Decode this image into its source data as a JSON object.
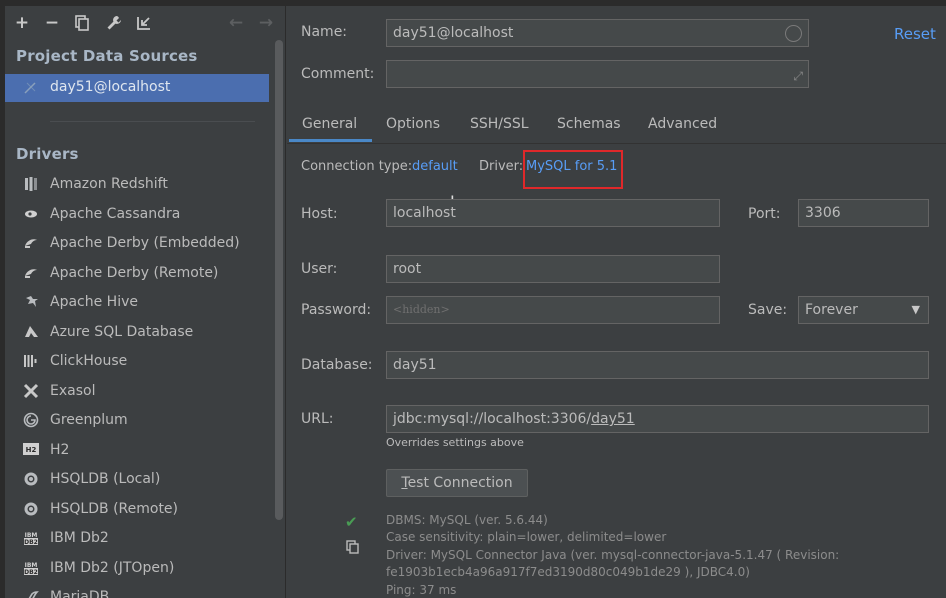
{
  "left_panel": {
    "section_project": "Project Data Sources",
    "selected_source": "day51@localhost",
    "section_drivers": "Drivers",
    "drivers": [
      {
        "label": "Amazon Redshift",
        "icon": "redshift-icon"
      },
      {
        "label": "Apache Cassandra",
        "icon": "cassandra-icon"
      },
      {
        "label": "Apache Derby (Embedded)",
        "icon": "derby-icon"
      },
      {
        "label": "Apache Derby (Remote)",
        "icon": "derby-icon"
      },
      {
        "label": "Apache Hive",
        "icon": "hive-icon"
      },
      {
        "label": "Azure SQL Database",
        "icon": "azure-icon"
      },
      {
        "label": "ClickHouse",
        "icon": "clickhouse-icon"
      },
      {
        "label": "Exasol",
        "icon": "exasol-icon"
      },
      {
        "label": "Greenplum",
        "icon": "greenplum-icon"
      },
      {
        "label": "H2",
        "icon": "h2-icon"
      },
      {
        "label": "HSQLDB (Local)",
        "icon": "hsqldb-icon"
      },
      {
        "label": "HSQLDB (Remote)",
        "icon": "hsqldb-icon"
      },
      {
        "label": "IBM Db2",
        "icon": "db2-icon"
      },
      {
        "label": "IBM Db2 (JTOpen)",
        "icon": "db2-icon"
      },
      {
        "label": "MariaDB",
        "icon": "mariadb-icon"
      }
    ]
  },
  "right_panel": {
    "name_label": "Name:",
    "name_value": "day51@localhost",
    "reset_label": "Reset",
    "comment_label": "Comment:",
    "comment_value": "",
    "tabs": [
      "General",
      "Options",
      "SSH/SSL",
      "Schemas",
      "Advanced"
    ],
    "connection_type_label": "Connection type:",
    "connection_type_value": "default",
    "driver_label": "Driver:",
    "driver_value": "MySQL for 5.1",
    "host_label": "Host:",
    "host_value": "localhost",
    "port_label": "Port:",
    "port_value": "3306",
    "user_label": "User:",
    "user_value": "root",
    "password_label": "Password:",
    "password_placeholder": "<hidden>",
    "save_label": "Save:",
    "save_value": "Forever",
    "database_label": "Database:",
    "database_value": "day51",
    "url_label": "URL:",
    "url_prefix": "jdbc:mysql://localhost:3306/",
    "url_db": "day51",
    "url_hint": "Overrides settings above",
    "test_button": "Test Connection",
    "test_button_mnemonic": "T",
    "test_button_rest": "est Connection",
    "info_lines": [
      "DBMS: MySQL (ver. 5.6.44)",
      "Case sensitivity: plain=lower, delimited=lower",
      "Driver: MySQL Connector Java (ver. mysql-connector-java-5.1.47 ( Revision:",
      "fe1903b1ecb4a96a917f7ed3190d80c049b1de29 ), JDBC4.0)",
      "Ping: 37 ms"
    ]
  },
  "colors": {
    "background": "#3c3f41",
    "selection": "#4b6eaf",
    "link": "#589df6",
    "highlight_box": "#e0282a",
    "success": "#499c54"
  }
}
